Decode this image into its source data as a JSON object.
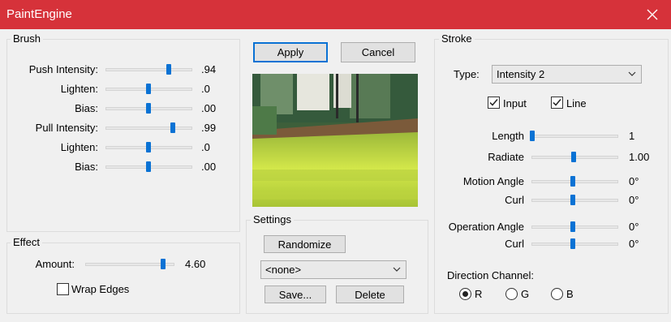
{
  "window": {
    "title": "PaintEngine"
  },
  "brush": {
    "label": "Brush",
    "rows": [
      {
        "label": "Push Intensity:",
        "value": ".94",
        "level": 0.72
      },
      {
        "label": "Lighten:",
        "value": ".0",
        "level": 0.5
      },
      {
        "label": "Bias:",
        "value": ".00",
        "level": 0.5
      },
      {
        "label": "Pull Intensity:",
        "value": ".99",
        "level": 0.77
      },
      {
        "label": "Lighten:",
        "value": ".0",
        "level": 0.5
      },
      {
        "label": "Bias:",
        "value": ".00",
        "level": 0.5
      }
    ]
  },
  "effect": {
    "label": "Effect",
    "amount_label": "Amount:",
    "amount_value": "4.60",
    "amount_level": 0.92,
    "wrap_edges_label": "Wrap Edges",
    "wrap_edges_checked": false
  },
  "actions": {
    "apply_label": "Apply",
    "cancel_label": "Cancel"
  },
  "settings": {
    "label": "Settings",
    "randomize_label": "Randomize",
    "preset_value": "<none>",
    "save_label": "Save...",
    "delete_label": "Delete"
  },
  "stroke": {
    "label": "Stroke",
    "type_label": "Type:",
    "type_value": "Intensity 2",
    "input_label": "Input",
    "input_checked": true,
    "line_label": "Line",
    "line_checked": true,
    "rows": [
      {
        "label": "Length",
        "value": "1",
        "level": 0.0
      },
      {
        "label": "Radiate",
        "value": "1.00",
        "level": 0.5
      },
      {
        "label": "Motion Angle",
        "value": "0°",
        "level": 0.5
      },
      {
        "label": "Curl",
        "value": "0°",
        "level": 0.5
      },
      {
        "label": "Operation Angle",
        "value": "0°",
        "level": 0.5
      },
      {
        "label": "Curl",
        "value": "0°",
        "level": 0.5
      }
    ],
    "direction_label": "Direction Channel:",
    "channels": [
      {
        "label": "R",
        "selected": true
      },
      {
        "label": "G",
        "selected": false
      },
      {
        "label": "B",
        "selected": false
      }
    ]
  }
}
